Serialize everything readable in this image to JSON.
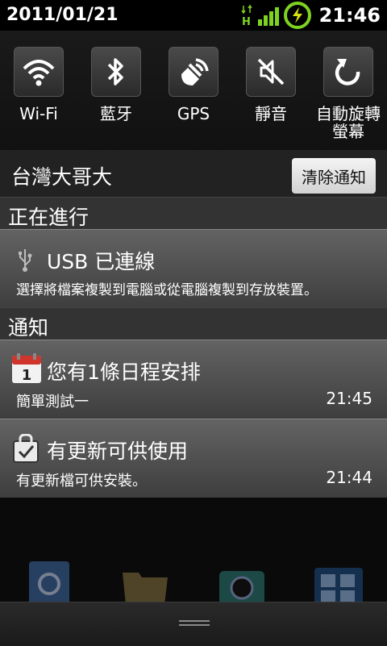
{
  "status_bar": {
    "date": "2011/01/21",
    "network_badge": "H",
    "time": "21:46",
    "icons": [
      "data-arrows-icon",
      "signal-icon",
      "battery-charging-icon"
    ]
  },
  "quick_settings": [
    {
      "label": "Wi-Fi",
      "icon": "wifi-icon"
    },
    {
      "label": "藍牙",
      "icon": "bluetooth-icon"
    },
    {
      "label": "GPS",
      "icon": "gps-icon"
    },
    {
      "label": "靜音",
      "icon": "mute-icon"
    },
    {
      "label": "自動旋轉\n螢幕",
      "icon": "rotate-icon"
    }
  ],
  "carrier": {
    "name": "台灣大哥大",
    "clear_button": "清除通知"
  },
  "ongoing": {
    "header": "正在進行",
    "usb": {
      "title": "USB 已連線",
      "subtitle": "選擇將檔案複製到電腦或從電腦複製到存放裝置。",
      "icon": "usb-icon"
    }
  },
  "notifications": {
    "header": "通知",
    "items": [
      {
        "title": "您有1條日程安排",
        "subtitle": "簡單測試一",
        "time": "21:45",
        "icon": "calendar-icon",
        "icon_text": "1"
      },
      {
        "title": "有更新可供使用",
        "subtitle": "有更新檔可供安裝。",
        "time": "21:44",
        "icon": "update-bag-icon"
      }
    ]
  },
  "dock_icons": [
    "contacts-icon",
    "folder-icon",
    "camera-icon",
    "grid-app-icon"
  ],
  "colors": {
    "accent_green": "#7ed321",
    "bolt_yellow": "#d7e40a"
  }
}
